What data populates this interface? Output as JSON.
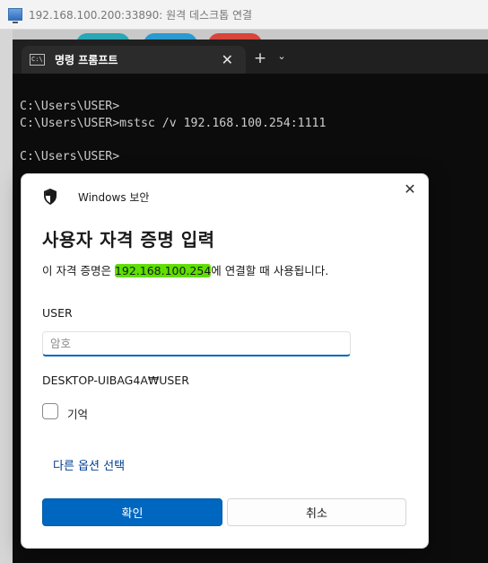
{
  "rdp_window": {
    "title": "192.168.100.200:33890: 원격 데스크톱 연결"
  },
  "terminal": {
    "tab_label": "명령 프롬프트",
    "tab_close": "✕",
    "new_tab": "+",
    "dropdown": "⌄",
    "lines": [
      "C:\\Users\\USER>",
      "C:\\Users\\USER>mstsc /v 192.168.100.254:1111",
      "",
      "C:\\Users\\USER>"
    ]
  },
  "dialog": {
    "header": "Windows 보안",
    "close": "✕",
    "title": "사용자 자격 증명 입력",
    "description_prefix": "이 자격 증명은 ",
    "description_host": "192.168.100.254",
    "description_suffix": "에 연결할 때 사용됩니다.",
    "username": "USER",
    "password_placeholder": "암호",
    "domain_user": "DESKTOP-UIBAG4A₩USER",
    "remember_label": "기억",
    "more_options": "다른 옵션 선택",
    "ok_label": "확인",
    "cancel_label": "취소"
  },
  "colors": {
    "accent": "#0067c0",
    "highlight": "#5ee000",
    "terminal_bg": "#0c0c0c",
    "link": "#003e92"
  }
}
